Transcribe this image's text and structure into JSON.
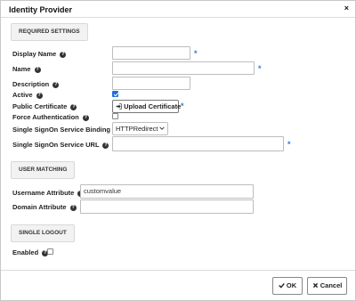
{
  "dialog": {
    "title": "Identity Provider",
    "close_glyph": "×"
  },
  "sections": {
    "required": "REQUIRED SETTINGS",
    "user_matching": "USER MATCHING",
    "single_logout": "SINGLE LOGOUT"
  },
  "fields": {
    "display_name": {
      "label": "Display Name",
      "value": ""
    },
    "name": {
      "label": "Name",
      "value": ""
    },
    "description": {
      "label": "Description",
      "value": ""
    },
    "active": {
      "label": "Active",
      "checked": true
    },
    "public_certificate": {
      "label": "Public Certificate",
      "button": "Upload Certificate"
    },
    "force_authentication": {
      "label": "Force Authentication",
      "checked": false
    },
    "sso_binding": {
      "label": "Single SignOn Service Binding",
      "value": "HTTPRedirect"
    },
    "sso_url": {
      "label": "Single SignOn Service URL",
      "value": ""
    },
    "username_attribute": {
      "label": "Username Attribute",
      "value": "customvalue"
    },
    "domain_attribute": {
      "label": "Domain Attribute",
      "value": ""
    },
    "logout_enabled": {
      "label": "Enabled",
      "checked": false
    }
  },
  "required_marker": "*",
  "help_glyph": "?",
  "footer": {
    "ok": "OK",
    "cancel": "Cancel"
  },
  "icons": {
    "help": "question-circle-icon",
    "upload": "sign-in-icon",
    "ok": "check-icon",
    "cancel": "times-icon"
  },
  "colors": {
    "required_marker": "#2e7dd7",
    "checkbox_on": "#1f6fdc"
  }
}
